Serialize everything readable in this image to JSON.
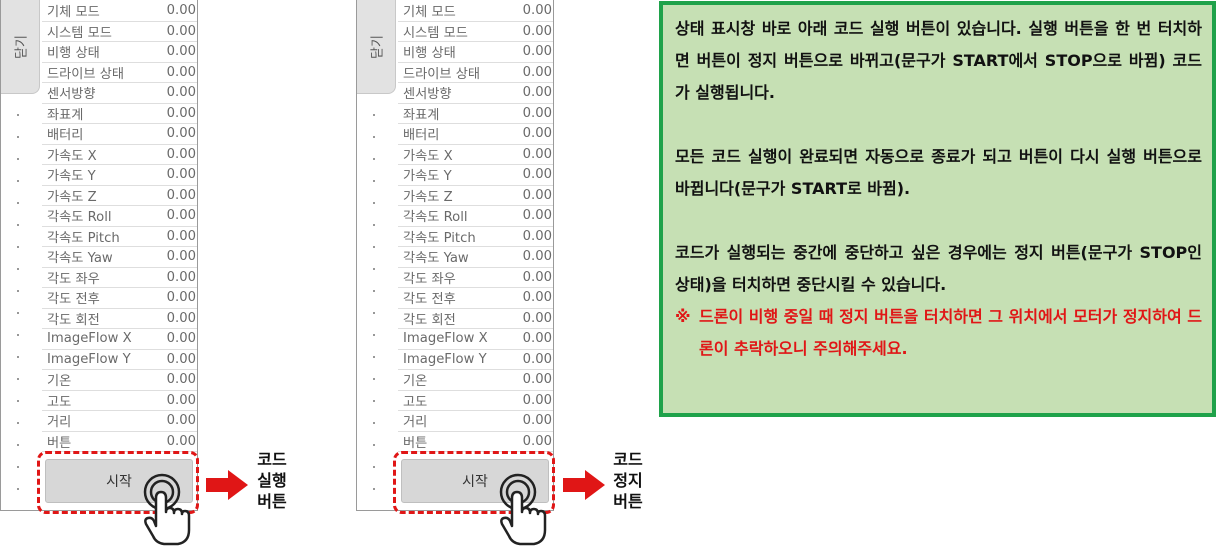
{
  "screens": [
    {
      "close_tab": "닫기",
      "start_button": "시작",
      "callout": [
        "코드",
        "실행",
        "버튼"
      ]
    },
    {
      "close_tab": "닫기",
      "start_button": "시작",
      "callout": [
        "코드",
        "정지",
        "버튼"
      ]
    }
  ],
  "status_rows": [
    {
      "label": "기체 모드",
      "value": "0.00"
    },
    {
      "label": "시스템 모드",
      "value": "0.00"
    },
    {
      "label": "비행 상태",
      "value": "0.00"
    },
    {
      "label": "드라이브 상태",
      "value": "0.00"
    },
    {
      "label": "센서방향",
      "value": "0.00"
    },
    {
      "label": "좌표계",
      "value": "0.00"
    },
    {
      "label": "배터리",
      "value": "0.00"
    },
    {
      "label": "가속도 X",
      "value": "0.00"
    },
    {
      "label": "가속도 Y",
      "value": "0.00"
    },
    {
      "label": "가속도 Z",
      "value": "0.00"
    },
    {
      "label": "각속도 Roll",
      "value": "0.00"
    },
    {
      "label": "각속도 Pitch",
      "value": "0.00"
    },
    {
      "label": "각속도 Yaw",
      "value": "0.00"
    },
    {
      "label": "각도 좌우",
      "value": "0.00"
    },
    {
      "label": "각도 전후",
      "value": "0.00"
    },
    {
      "label": "각도 회전",
      "value": "0.00"
    },
    {
      "label": "ImageFlow X",
      "value": "0.00"
    },
    {
      "label": "ImageFlow Y",
      "value": "0.00"
    },
    {
      "label": "기온",
      "value": "0.00"
    },
    {
      "label": "고도",
      "value": "0.00"
    },
    {
      "label": "거리",
      "value": "0.00"
    },
    {
      "label": "버튼",
      "value": "0.00"
    }
  ],
  "note": {
    "para1": "상태 표시창 바로 아래 코드 실행 버튼이 있습니다. 실행 버튼을 한 번 터치하면 버튼이 정지 버튼으로 바뀌고(문구가 START에서 STOP으로 바뀜) 코드가 실행됩니다.",
    "para2": "모든 코드 실행이 완료되면 자동으로 종료가 되고 버튼이 다시 실행 버튼으로 바뀝니다(문구가 START로 바뀜).",
    "para3": "코드가 실행되는 중간에 중단하고 싶은 경우에는 정지 버튼(문구가 STOP인 상태)을 터치하면 중단시킬 수 있습니다.",
    "warning_mark": "※",
    "warning": "드론이 비행 중일 때 정지 버튼을 터치하면 그 위치에서 모터가 정지하여 드론이 추락하오니 주의해주세요.",
    "accent_color": "#e01616",
    "border_color": "#1fa24a",
    "background_color": "#c6e0b4"
  }
}
